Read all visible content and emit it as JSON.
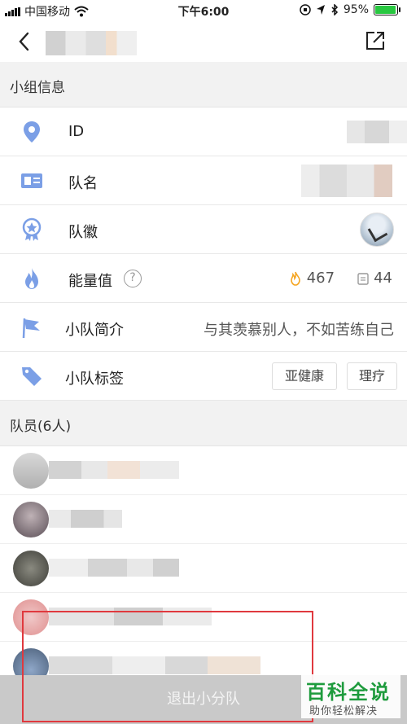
{
  "status_bar": {
    "carrier": "中国移动",
    "time": "下午6:00",
    "battery": "95%",
    "battery_level": 0.95
  },
  "nav": {
    "back_icon": "chevron-left-icon",
    "share_icon": "share-icon"
  },
  "group_info": {
    "header": "小组信息",
    "id_label": "ID",
    "name_label": "队名",
    "badge_label": "队徽",
    "energy_label": "能量值",
    "energy_help": "?",
    "energy_fire_value": "467",
    "energy_other_value": "44",
    "intro_label": "小队简介",
    "intro_value": "与其羡慕别人，不如苦练自己",
    "tags_label": "小队标签",
    "tags": [
      "亚健康",
      "理疗"
    ]
  },
  "members": {
    "header": "队员(6人)",
    "count": 5
  },
  "exit_button": "退出小分队",
  "watermark": {
    "title": "百科全说",
    "subtitle": "助你轻松解决"
  },
  "colors": {
    "icon_blue": "#7b9fe6",
    "highlight_red": "#e0393e",
    "watermark_green": "#1e9b3d",
    "fire_orange": "#f5a623"
  }
}
